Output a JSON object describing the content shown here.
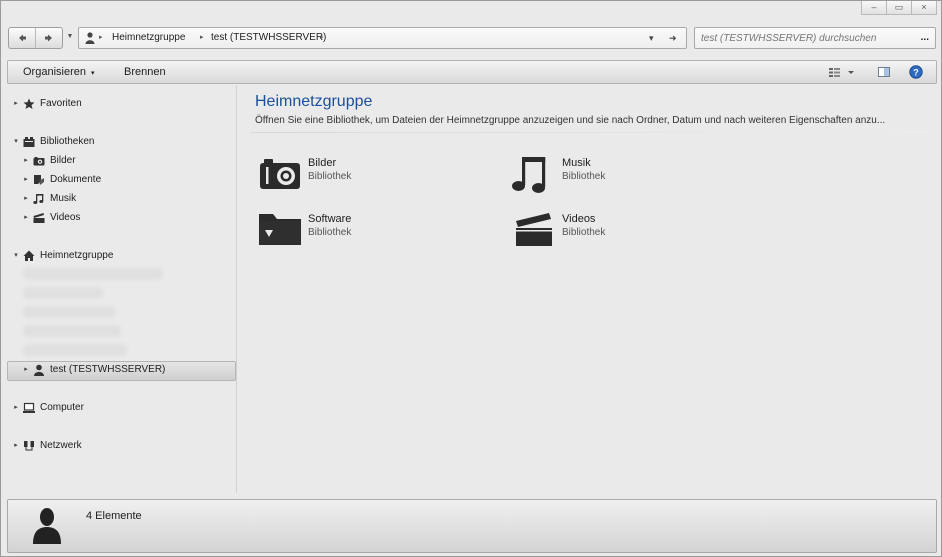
{
  "window": {
    "controls": {
      "minimize": "–",
      "maximize": "▭",
      "close": "×"
    }
  },
  "navigation": {
    "back_icon": "back-arrow-icon",
    "forward_icon": "forward-arrow-icon",
    "recent_icon": "chevron-down-icon"
  },
  "address_bar": {
    "location_icon": "user-icon",
    "breadcrumb": [
      "Heimnetzgruppe",
      "test (TESTWHSSERVER)"
    ],
    "separator": "▸",
    "dropdown_glyph": "▾",
    "refresh_glyph": "➜"
  },
  "search": {
    "placeholder": "test (TESTWHSSERVER) durchsuchen",
    "button_label": "..."
  },
  "toolbar": {
    "organize_label": "Organisieren",
    "organize_arrow": "▾",
    "burn_label": "Brennen",
    "view_icon": "view-options-icon",
    "preview_icon": "preview-pane-icon",
    "help_icon": "help-icon",
    "help_glyph": "?"
  },
  "sidebar": {
    "favorites": {
      "label": "Favoriten",
      "icon": "star-icon"
    },
    "libraries": {
      "label": "Bibliotheken",
      "icon": "libraries-icon",
      "items": [
        {
          "label": "Bilder",
          "icon": "camera-icon"
        },
        {
          "label": "Dokumente",
          "icon": "document-icon"
        },
        {
          "label": "Musik",
          "icon": "music-note-icon"
        },
        {
          "label": "Videos",
          "icon": "clapperboard-icon"
        }
      ]
    },
    "homegroup": {
      "label": "Heimnetzgruppe",
      "icon": "house-icon",
      "selected_item": {
        "label": "test (TESTWHSSERVER)",
        "icon": "user-icon"
      }
    },
    "computer": {
      "label": "Computer",
      "icon": "laptop-icon"
    },
    "network": {
      "label": "Netzwerk",
      "icon": "network-icon"
    }
  },
  "main": {
    "heading": "Heimnetzgruppe",
    "description": "Öffnen Sie eine Bibliothek, um Dateien der Heimnetzgruppe anzuzeigen und sie nach Ordner, Datum und nach weiteren Eigenschaften anzu...",
    "libraries": [
      {
        "name": "Bilder",
        "type": "Bibliothek",
        "icon": "camera-icon"
      },
      {
        "name": "Musik",
        "type": "Bibliothek",
        "icon": "music-note-icon"
      },
      {
        "name": "Software",
        "type": "Bibliothek",
        "icon": "folder-icon"
      },
      {
        "name": "Videos",
        "type": "Bibliothek",
        "icon": "clapperboard-icon"
      }
    ]
  },
  "status": {
    "count_text": "4 Elemente",
    "icon": "user-silhouette-icon"
  }
}
